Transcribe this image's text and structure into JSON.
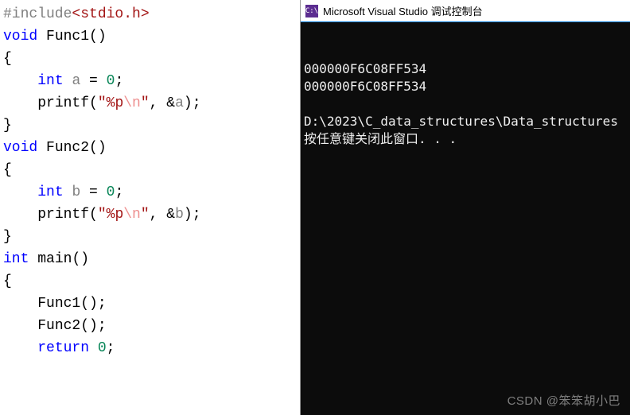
{
  "code": {
    "lines": [
      {
        "tokens": [
          {
            "cls": "tok-directive",
            "t": "#include"
          },
          {
            "cls": "tok-include-path",
            "t": "<stdio.h>"
          }
        ]
      },
      {
        "tokens": [
          {
            "cls": "tok-keyword",
            "t": "void"
          },
          {
            "cls": "tok-plain",
            "t": " "
          },
          {
            "cls": "tok-func",
            "t": "Func1"
          },
          {
            "cls": "tok-punct",
            "t": "()"
          }
        ]
      },
      {
        "tokens": [
          {
            "cls": "tok-punct",
            "t": "{"
          }
        ]
      },
      {
        "tokens": [
          {
            "cls": "indent-guide",
            "t": "    "
          },
          {
            "cls": "tok-keyword",
            "t": "int"
          },
          {
            "cls": "tok-plain",
            "t": " "
          },
          {
            "cls": "tok-var",
            "t": "a"
          },
          {
            "cls": "tok-plain",
            "t": " = "
          },
          {
            "cls": "tok-num",
            "t": "0"
          },
          {
            "cls": "tok-punct",
            "t": ";"
          }
        ]
      },
      {
        "tokens": [
          {
            "cls": "indent-guide",
            "t": "    "
          },
          {
            "cls": "tok-func",
            "t": "printf"
          },
          {
            "cls": "tok-punct",
            "t": "("
          },
          {
            "cls": "tok-string",
            "t": "\"%p"
          },
          {
            "cls": "tok-escape",
            "t": "\\n"
          },
          {
            "cls": "tok-string",
            "t": "\""
          },
          {
            "cls": "tok-punct",
            "t": ", &"
          },
          {
            "cls": "tok-var",
            "t": "a"
          },
          {
            "cls": "tok-punct",
            "t": ");"
          }
        ]
      },
      {
        "tokens": [
          {
            "cls": "tok-punct",
            "t": "}"
          }
        ]
      },
      {
        "tokens": [
          {
            "cls": "tok-keyword",
            "t": "void"
          },
          {
            "cls": "tok-plain",
            "t": " "
          },
          {
            "cls": "tok-func",
            "t": "Func2"
          },
          {
            "cls": "tok-punct",
            "t": "()"
          }
        ]
      },
      {
        "tokens": [
          {
            "cls": "tok-punct",
            "t": "{"
          }
        ]
      },
      {
        "tokens": [
          {
            "cls": "indent-guide",
            "t": "    "
          },
          {
            "cls": "tok-keyword",
            "t": "int"
          },
          {
            "cls": "tok-plain",
            "t": " "
          },
          {
            "cls": "tok-var",
            "t": "b"
          },
          {
            "cls": "tok-plain",
            "t": " = "
          },
          {
            "cls": "tok-num",
            "t": "0"
          },
          {
            "cls": "tok-punct",
            "t": ";"
          }
        ]
      },
      {
        "tokens": [
          {
            "cls": "indent-guide",
            "t": "    "
          },
          {
            "cls": "tok-func",
            "t": "printf"
          },
          {
            "cls": "tok-punct",
            "t": "("
          },
          {
            "cls": "tok-string",
            "t": "\"%p"
          },
          {
            "cls": "tok-escape",
            "t": "\\n"
          },
          {
            "cls": "tok-string",
            "t": "\""
          },
          {
            "cls": "tok-punct",
            "t": ", &"
          },
          {
            "cls": "tok-var",
            "t": "b"
          },
          {
            "cls": "tok-punct",
            "t": ");"
          }
        ]
      },
      {
        "tokens": [
          {
            "cls": "tok-punct",
            "t": "}"
          }
        ]
      },
      {
        "tokens": [
          {
            "cls": "tok-keyword",
            "t": "int"
          },
          {
            "cls": "tok-plain",
            "t": " "
          },
          {
            "cls": "tok-func",
            "t": "main"
          },
          {
            "cls": "tok-punct",
            "t": "()"
          }
        ]
      },
      {
        "tokens": [
          {
            "cls": "tok-punct",
            "t": "{"
          }
        ]
      },
      {
        "tokens": [
          {
            "cls": "indent-guide",
            "t": "    "
          },
          {
            "cls": "tok-func",
            "t": "Func1"
          },
          {
            "cls": "tok-punct",
            "t": "();"
          }
        ]
      },
      {
        "tokens": [
          {
            "cls": "indent-guide",
            "t": "    "
          },
          {
            "cls": "tok-func",
            "t": "Func2"
          },
          {
            "cls": "tok-punct",
            "t": "();"
          }
        ]
      },
      {
        "tokens": [
          {
            "cls": "indent-guide",
            "t": "    "
          },
          {
            "cls": "tok-keyword",
            "t": "return"
          },
          {
            "cls": "tok-plain",
            "t": " "
          },
          {
            "cls": "tok-num",
            "t": "0"
          },
          {
            "cls": "tok-punct",
            "t": ";"
          }
        ]
      }
    ]
  },
  "console": {
    "icon_text": "C:\\",
    "title": "Microsoft Visual Studio 调试控制台",
    "output": [
      "000000F6C08FF534",
      "000000F6C08FF534",
      "",
      "D:\\2023\\C_data_structures\\Data_structures",
      "按任意键关闭此窗口. . ."
    ]
  },
  "watermark": "CSDN @笨笨胡小巴"
}
